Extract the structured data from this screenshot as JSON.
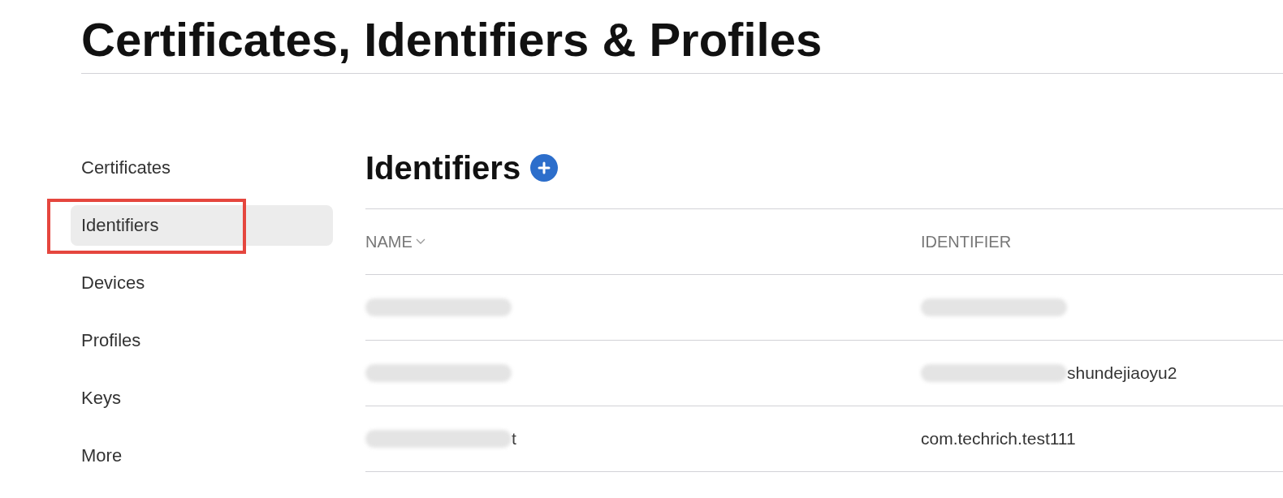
{
  "page_title": "Certificates, Identifiers & Profiles",
  "sidebar": {
    "items": [
      {
        "label": "Certificates",
        "selected": false,
        "highlighted": false
      },
      {
        "label": "Identifiers",
        "selected": true,
        "highlighted": true
      },
      {
        "label": "Devices",
        "selected": false,
        "highlighted": false
      },
      {
        "label": "Profiles",
        "selected": false,
        "highlighted": false
      },
      {
        "label": "Keys",
        "selected": false,
        "highlighted": false
      },
      {
        "label": "More",
        "selected": false,
        "highlighted": false
      }
    ]
  },
  "section": {
    "title": "Identifiers"
  },
  "table": {
    "columns": [
      {
        "label": "NAME",
        "sorted": true
      },
      {
        "label": "IDENTIFIER",
        "sorted": false
      }
    ],
    "rows": [
      {
        "cells": [
          {
            "redacted": true
          },
          {
            "redacted": true
          }
        ]
      },
      {
        "cells": [
          {
            "redacted": true
          },
          {
            "redacted": true,
            "visible": "shundejiaoyu2"
          }
        ]
      },
      {
        "cells": [
          {
            "redacted": true,
            "visible": "t"
          },
          {
            "redacted": false,
            "visible": "com.techrich.test111"
          }
        ]
      }
    ]
  }
}
